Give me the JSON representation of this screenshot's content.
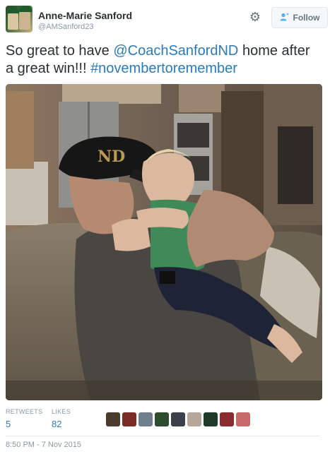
{
  "user": {
    "display_name": "Anne-Marie Sanford",
    "handle": "@AMSanford23"
  },
  "actions": {
    "follow_label": "Follow"
  },
  "tweet": {
    "text_1": "So great to have ",
    "mention": "@CoachSanfordND",
    "text_2": " home after a great win!!! ",
    "hashtag": "#novembertoremember"
  },
  "stats": {
    "retweets_label": "RETWEETS",
    "retweets_value": "5",
    "likes_label": "LIKES",
    "likes_value": "82"
  },
  "liker_avatars": [
    {
      "icon": "liker-avatar-icon",
      "color": "#4a3b2e"
    },
    {
      "icon": "liker-avatar-icon",
      "color": "#7a2b24"
    },
    {
      "icon": "liker-avatar-icon",
      "color": "#6f7f8d"
    },
    {
      "icon": "liker-avatar-icon",
      "color": "#2f4b2f"
    },
    {
      "icon": "liker-avatar-icon",
      "color": "#3a3f4a"
    },
    {
      "icon": "liker-avatar-icon",
      "color": "#b7a79a"
    },
    {
      "icon": "liker-avatar-icon",
      "color": "#1f3a26"
    },
    {
      "icon": "liker-avatar-icon",
      "color": "#8a2b30"
    },
    {
      "icon": "liker-avatar-icon",
      "color": "#c96a6a"
    }
  ],
  "timestamp": "8:50 PM - 7 Nov 2015",
  "colors": {
    "link": "#2b7bb9",
    "muted": "#8899a6",
    "text": "#292f33"
  }
}
